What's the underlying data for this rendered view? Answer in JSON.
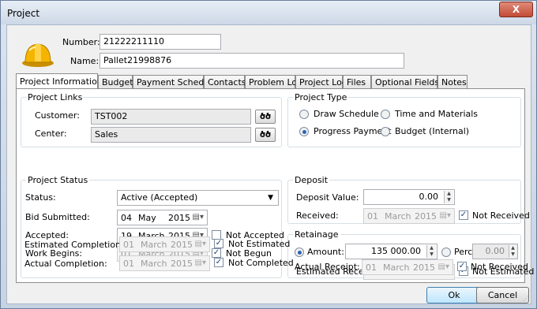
{
  "window": {
    "title": "Project",
    "close_glyph": "X"
  },
  "header": {
    "number_label": "Number:",
    "number_value": "21222211110",
    "name_label": "Name:",
    "name_value": "Pallet21998876"
  },
  "tabs": [
    {
      "label": "Project Information"
    },
    {
      "label": "Budget"
    },
    {
      "label": "Payment Schedule"
    },
    {
      "label": "Contacts"
    },
    {
      "label": "Problem Log"
    },
    {
      "label": "Project Log"
    },
    {
      "label": "Files"
    },
    {
      "label": "Optional Fields"
    },
    {
      "label": "Notes"
    }
  ],
  "project_links": {
    "title": "Project Links",
    "customer_label": "Customer:",
    "customer_value": "TST002",
    "center_label": "Center:",
    "center_value": "Sales"
  },
  "project_type": {
    "title": "Project Type",
    "opt_draw": "Draw Schedule",
    "opt_time": "Time and Materials",
    "opt_progress": "Progress Payment",
    "opt_budget": "Budget (Internal)"
  },
  "project_status": {
    "title": "Project Status",
    "status_label": "Status:",
    "status_value": "Active (Accepted)",
    "bid_label": "Bid Submitted:",
    "bid_day": "04",
    "bid_month": "May",
    "bid_year": "2015",
    "accepted_label": "Accepted:",
    "acc_day": "19",
    "acc_month": "March",
    "acc_year": "2015",
    "not_accepted": "Not Accepted",
    "work_label": "Work Begins:",
    "work_day": "01",
    "work_month": "March",
    "work_year": "2015",
    "not_begun": "Not Begun",
    "est_label": "Estimated Completion:",
    "est_day": "01",
    "est_month": "March",
    "est_year": "2015",
    "not_estimated": "Not Estimated",
    "act_label": "Actual Completion:",
    "act_day": "01",
    "act_month": "March",
    "act_year": "2015",
    "not_completed": "Not Completed"
  },
  "deposit": {
    "title": "Deposit",
    "value_label": "Deposit Value:",
    "value": "0.00",
    "received_label": "Received:",
    "rec_day": "01",
    "rec_month": "March",
    "rec_year": "2015",
    "not_received": "Not Received"
  },
  "retainage": {
    "title": "Retainage",
    "amount_label": "Amount:",
    "amount_value": "135 000.00",
    "percent_label": "Percent:",
    "percent_value": "0.00",
    "est_label": "Estimated Receipt:",
    "est_day": "01",
    "est_month": "March",
    "est_year": "2015",
    "not_estimated": "Not Estimated",
    "act_label": "Actual Receipt:",
    "act_day": "01",
    "act_month": "March",
    "act_year": "2015",
    "not_received": "Not Received"
  },
  "footer": {
    "ok": "Ok",
    "cancel": "Cancel"
  },
  "icons": {
    "lookup": "binoculars-icon",
    "calendar": "calendar-icon"
  },
  "colors": {
    "accent": "#2b63b5",
    "helmet": "#f5b400"
  }
}
